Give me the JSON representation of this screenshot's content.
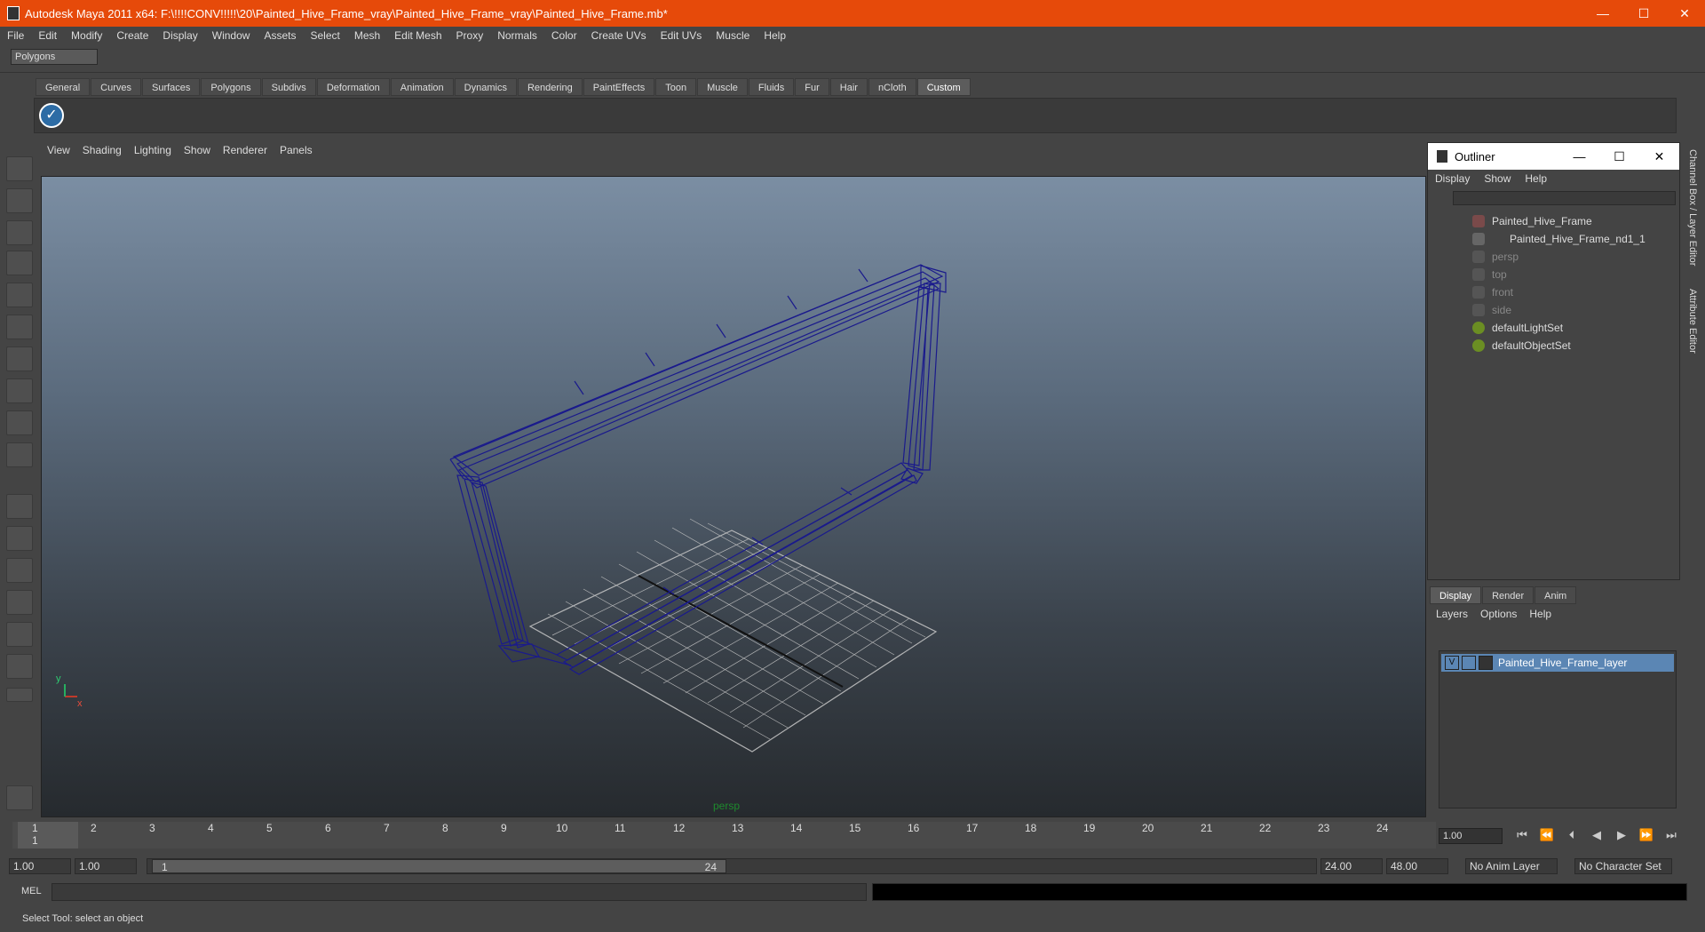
{
  "window": {
    "title": "Autodesk Maya 2011 x64: F:\\!!!!CONV!!!!!\\20\\Painted_Hive_Frame_vray\\Painted_Hive_Frame_vray\\Painted_Hive_Frame.mb*",
    "minimize": "—",
    "maximize": "☐",
    "close": "✕"
  },
  "menubar": [
    "File",
    "Edit",
    "Modify",
    "Create",
    "Display",
    "Window",
    "Assets",
    "Select",
    "Mesh",
    "Edit Mesh",
    "Proxy",
    "Normals",
    "Color",
    "Create UVs",
    "Edit UVs",
    "Muscle",
    "Help"
  ],
  "mode_selector": "Polygons",
  "shelf_tabs": [
    "General",
    "Curves",
    "Surfaces",
    "Polygons",
    "Subdivs",
    "Deformation",
    "Animation",
    "Dynamics",
    "Rendering",
    "PaintEffects",
    "Toon",
    "Muscle",
    "Fluids",
    "Fur",
    "Hair",
    "nCloth",
    "Custom"
  ],
  "active_shelf_tab": "Custom",
  "shelf_icon": "checkmark-icon",
  "panel_menu": [
    "View",
    "Shading",
    "Lighting",
    "Show",
    "Renderer",
    "Panels"
  ],
  "viewport": {
    "camera_label": "persp",
    "axis_labels": {
      "x": "x",
      "y": "y"
    },
    "colors": {
      "wireframe": "#1a1a8c",
      "grid": "#c8c8c8",
      "camera_label": "#1e8a2d"
    }
  },
  "outliner": {
    "title": "Outliner",
    "menu": [
      "Display",
      "Show",
      "Help"
    ],
    "items": [
      {
        "label": "Painted_Hive_Frame",
        "dim": false
      },
      {
        "label": "Painted_Hive_Frame_nd1_1",
        "dim": false
      },
      {
        "label": "persp",
        "dim": true
      },
      {
        "label": "top",
        "dim": true
      },
      {
        "label": "front",
        "dim": true
      },
      {
        "label": "side",
        "dim": true
      },
      {
        "label": "defaultLightSet",
        "dim": false
      },
      {
        "label": "defaultObjectSet",
        "dim": false
      }
    ]
  },
  "side_tabs": [
    "Channel Box / Layer Editor",
    "Attribute Editor"
  ],
  "layer_editor": {
    "tabs": [
      "Display",
      "Render",
      "Anim"
    ],
    "active_tab": "Display",
    "menu": [
      "Layers",
      "Options",
      "Help"
    ],
    "layer": {
      "visibility": "V",
      "name": "Painted_Hive_Frame_layer"
    },
    "colors": {
      "selected_row": "#5b86b4"
    }
  },
  "timeline": {
    "ticks": [
      "1",
      "2",
      "3",
      "4",
      "5",
      "6",
      "7",
      "8",
      "9",
      "10",
      "11",
      "12",
      "13",
      "14",
      "15",
      "16",
      "17",
      "18",
      "19",
      "20",
      "21",
      "22",
      "23",
      "24"
    ],
    "current_frame_marker": "1",
    "current_frame": "1.00",
    "playback_buttons": [
      "⏮",
      "⏪",
      "⏴",
      "◀",
      "▶",
      "⏩",
      "⏭"
    ]
  },
  "range": {
    "start": "1.00",
    "playback_start": "1.00",
    "slider_start": "1",
    "slider_end": "24",
    "playback_end": "24.00",
    "end": "48.00",
    "anim_layer": "No Anim Layer",
    "character_set": "No Character Set"
  },
  "command_line": {
    "label": "MEL",
    "value": ""
  },
  "help_line": "Select Tool: select an object"
}
